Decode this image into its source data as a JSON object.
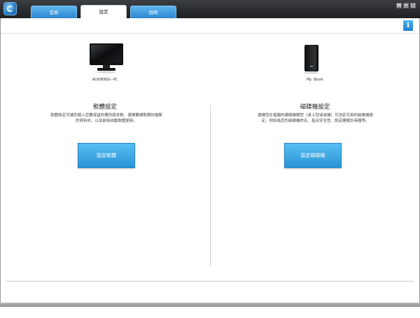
{
  "tabs": [
    {
      "label": "首頁",
      "active": false
    },
    {
      "label": "設定",
      "active": true
    },
    {
      "label": "說明",
      "active": false
    }
  ],
  "window_controls": {
    "minimize": "_",
    "maximize": "□",
    "close": "x"
  },
  "info_button": {
    "label": "i"
  },
  "computer_panel": {
    "device_label": "ACKOENIG-PC",
    "title": "軟體設定",
    "description": "軟體設定可讓您輸入您要保留的備份版本數、選擇要擷取備份檔案的資料夾，以及啟用自動軟體更新。",
    "button_label": "設定軟體",
    "icon": "monitor-icon"
  },
  "drive_panel": {
    "device_label": "My Book",
    "title": "磁碟機設定",
    "description": "選擇您在電腦的硬碟機類型（桌上型或桌機）可決定可用的磁碟機設定，例如為您的磁碟機命名、指派安全性、設定睡眠計時器等。",
    "button_label": "設定磁碟機",
    "icon": "external-drive-icon"
  },
  "colors": {
    "accent": "#2a94d6",
    "titlebar": "#2b2d30"
  }
}
